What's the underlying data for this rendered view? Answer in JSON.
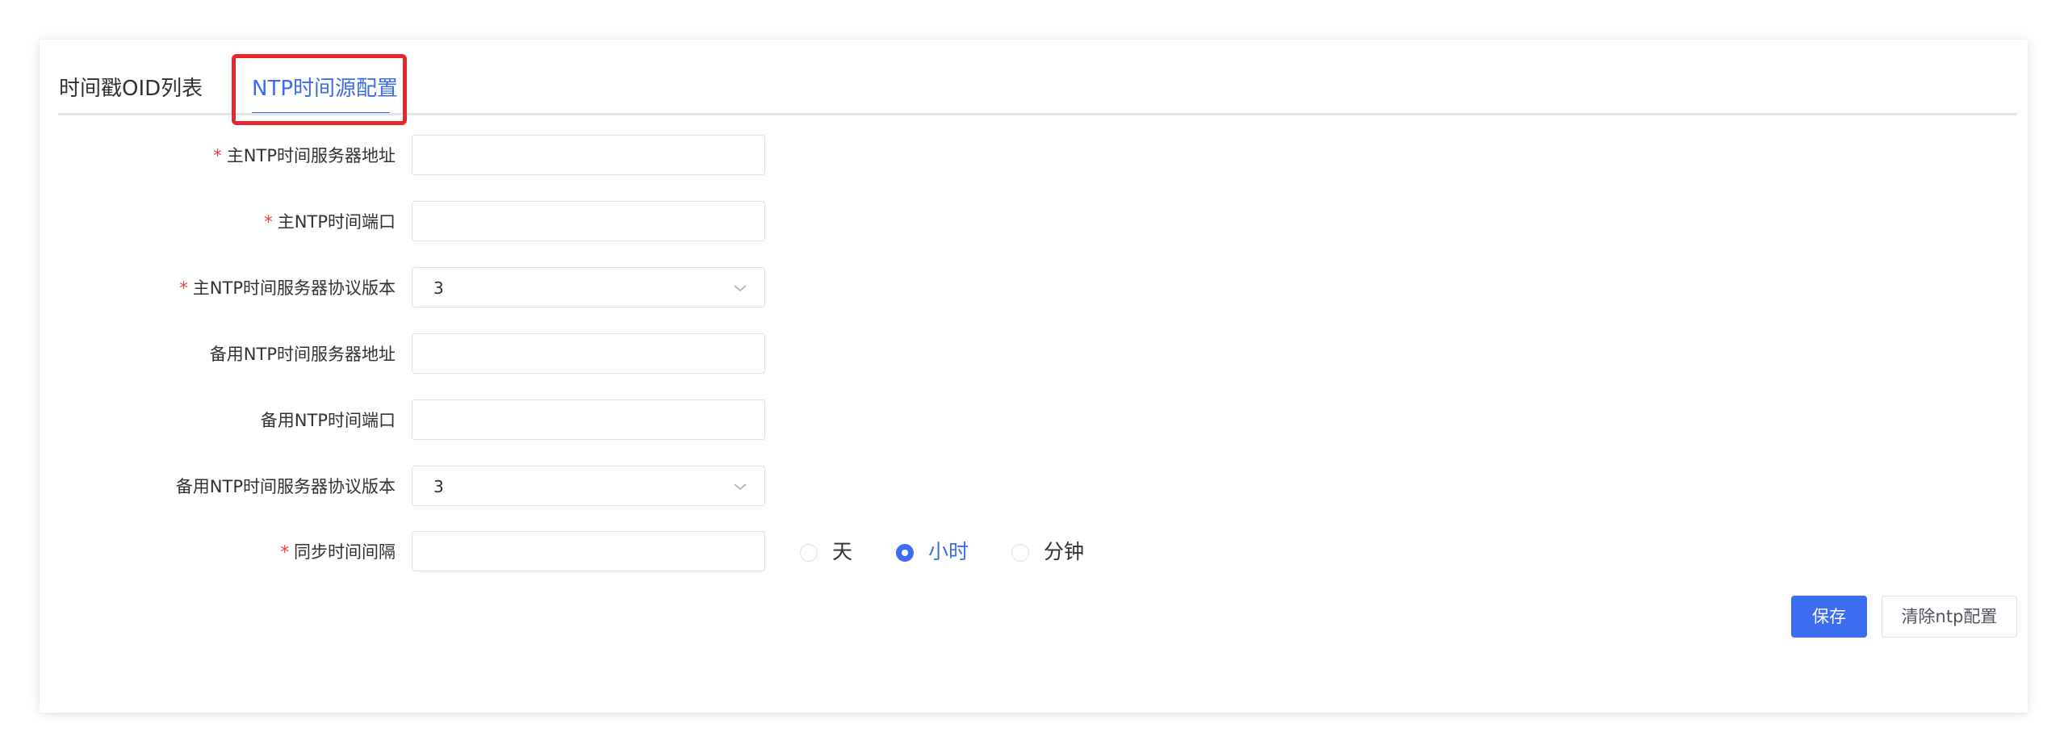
{
  "tabs": [
    {
      "label": "时间戳OID列表",
      "active": false
    },
    {
      "label": "NTP时间源配置",
      "active": true
    }
  ],
  "form": {
    "required_mark": "*",
    "primary_server_address": {
      "label": "主NTP时间服务器地址",
      "value": ""
    },
    "primary_port": {
      "label": "主NTP时间端口",
      "value": ""
    },
    "primary_version": {
      "label": "主NTP时间服务器协议版本",
      "value": "3"
    },
    "backup_server_address": {
      "label": "备用NTP时间服务器地址",
      "value": ""
    },
    "backup_port": {
      "label": "备用NTP时间端口",
      "value": ""
    },
    "backup_version": {
      "label": "备用NTP时间服务器协议版本",
      "value": "3"
    },
    "sync_interval": {
      "label": "同步时间间隔",
      "value": "",
      "units": [
        {
          "label": "天",
          "checked": false
        },
        {
          "label": "小时",
          "checked": true
        },
        {
          "label": "分钟",
          "checked": false
        }
      ]
    }
  },
  "actions": {
    "save_label": "保存",
    "clear_label": "清除ntp配置"
  },
  "icons": {
    "select_arrow": "chevron-down-icon"
  },
  "colors": {
    "accent": "#3c6cf0",
    "required": "#f03c3c",
    "highlight": "#e8262c"
  }
}
